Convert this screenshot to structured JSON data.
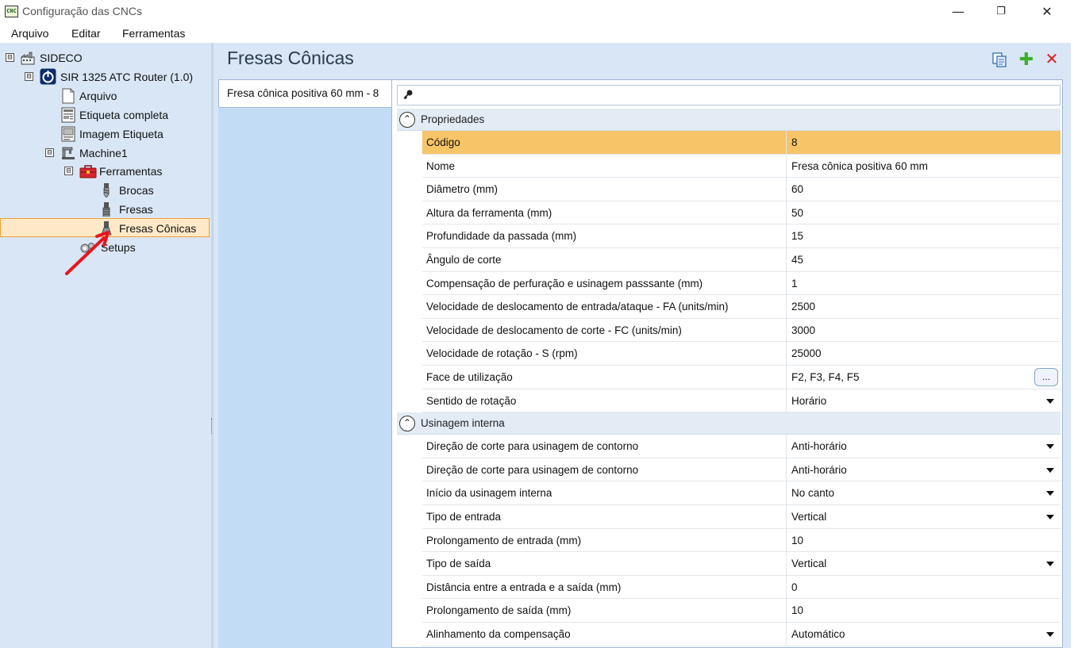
{
  "window": {
    "app_icon_text": "CNC",
    "title": "Configuração das CNCs",
    "minimize": "—",
    "maximize": "❐",
    "close": "✕"
  },
  "menu": [
    "Arquivo",
    "Editar",
    "Ferramentas"
  ],
  "tree": {
    "nodes": [
      {
        "label": "SIDECO",
        "icon": "factory-icon",
        "expander": "⊟"
      },
      {
        "label": "SIR 1325 ATC Router (1.0)",
        "icon": "router-power-icon",
        "expander": "⊟"
      },
      {
        "label": "Arquivo",
        "icon": "file-icon"
      },
      {
        "label": "Etiqueta completa",
        "icon": "label-icon"
      },
      {
        "label": "Imagem Etiqueta",
        "icon": "label-image-icon"
      },
      {
        "label": "Machine1",
        "icon": "machine-icon",
        "expander": "⊟"
      },
      {
        "label": "Ferramentas",
        "icon": "toolbox-icon",
        "expander": "⊟"
      },
      {
        "label": "Brocas",
        "icon": "drill-bit-icon"
      },
      {
        "label": "Fresas",
        "icon": "mill-bit-icon"
      },
      {
        "label": "Fresas Cônicas",
        "icon": "conical-mill-icon",
        "selected": true
      },
      {
        "label": "Setups",
        "icon": "setups-icon"
      }
    ]
  },
  "main": {
    "title": "Fresas Cônicas",
    "toolbar": {
      "copy_icon": "copy-icon",
      "add_icon": "add-icon",
      "delete_icon": "delete-icon",
      "add_glyph": "✚",
      "delete_glyph": "✕"
    },
    "tab_label": "Fresa cônica positiva 60 mm - 8",
    "search_icon_glyph": "🔑",
    "categories": [
      {
        "label": "Propriedades",
        "toggle": "⌃",
        "rows": [
          {
            "name": "Código",
            "value": "8",
            "selected": true
          },
          {
            "name": "Nome",
            "value": "Fresa cônica positiva 60 mm"
          },
          {
            "name": "Diâmetro (mm)",
            "value": "60"
          },
          {
            "name": "Altura da ferramenta (mm)",
            "value": "50"
          },
          {
            "name": "Profundidade da passada (mm)",
            "value": "15"
          },
          {
            "name": "Ângulo de corte",
            "value": "45"
          },
          {
            "name": "Compensação de perfuração e usinagem passsante (mm)",
            "value": "1"
          },
          {
            "name": "Velocidade de deslocamento de entrada/ataque - FA (units/min)",
            "value": "2500"
          },
          {
            "name": "Velocidade de deslocamento de corte - FC (units/min)",
            "value": "3000"
          },
          {
            "name": "Velocidade de rotação - S (rpm)",
            "value": "25000"
          },
          {
            "name": "Face de utilização",
            "value": "F2, F3, F4, F5",
            "ellipsis": "..."
          },
          {
            "name": "Sentido de rotação",
            "value": "Horário",
            "dropdown": true
          }
        ]
      },
      {
        "label": "Usinagem interna",
        "toggle": "⌃",
        "rows": [
          {
            "name": "Direção de corte para usinagem de contorno",
            "value": "Anti-horário",
            "dropdown": true
          },
          {
            "name": "Direção de corte para usinagem de contorno",
            "value": "Anti-horário",
            "dropdown": true
          },
          {
            "name": "Início da usinagem interna",
            "value": "No canto",
            "dropdown": true
          },
          {
            "name": "Tipo de entrada",
            "value": "Vertical",
            "dropdown": true
          },
          {
            "name": "Prolongamento de entrada (mm)",
            "value": "10"
          },
          {
            "name": "Tipo de saída",
            "value": "Vertical",
            "dropdown": true
          },
          {
            "name": "Distância entre a entrada e a saída (mm)",
            "value": "0"
          },
          {
            "name": "Prolongamento de saída (mm)",
            "value": "10"
          },
          {
            "name": "Alinhamento da compensação",
            "value": "Automático",
            "dropdown": true
          }
        ]
      }
    ]
  },
  "colors": {
    "panel_bg": "#d9e6f5",
    "selected_row": "#f7c467",
    "tree_selection": "#fde9c8",
    "annotation_arrow": "#e8141c"
  }
}
